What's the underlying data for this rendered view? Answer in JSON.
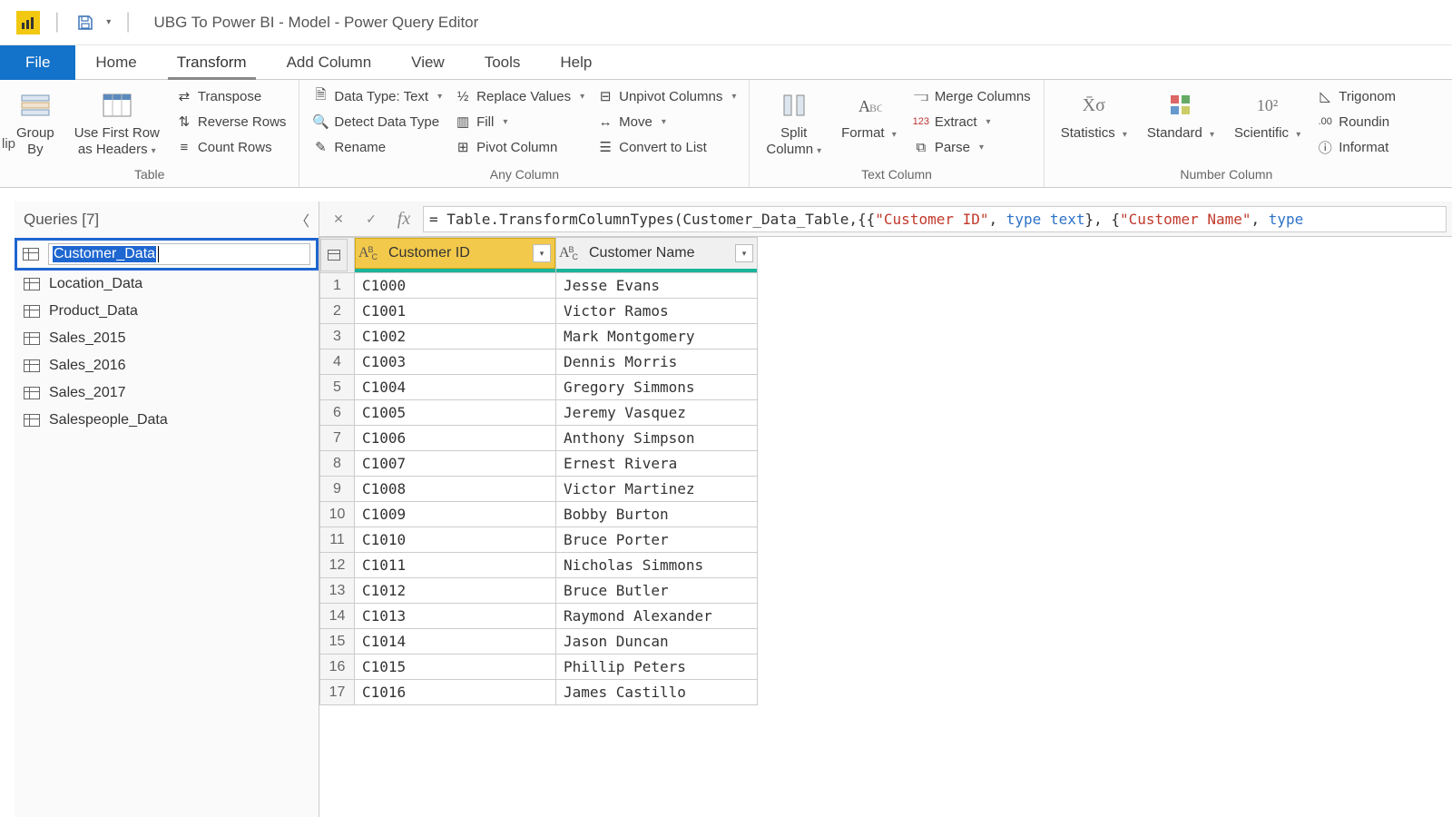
{
  "window": {
    "title": "UBG To Power BI - Model - Power Query Editor"
  },
  "tabs": {
    "file": "File",
    "items": [
      "Home",
      "Transform",
      "Add Column",
      "View",
      "Tools",
      "Help"
    ],
    "selected": "Transform"
  },
  "ribbon": {
    "groups": {
      "table": {
        "label": "Table",
        "group_by": "Group\nBy",
        "use_first_row": "Use First Row\nas Headers",
        "transpose": "Transpose",
        "reverse_rows": "Reverse Rows",
        "count_rows": "Count Rows"
      },
      "any_column": {
        "label": "Any Column",
        "data_type": "Data Type: Text",
        "detect": "Detect Data Type",
        "rename": "Rename",
        "replace": "Replace Values",
        "fill": "Fill",
        "pivot": "Pivot Column",
        "unpivot": "Unpivot Columns",
        "move": "Move",
        "convert": "Convert to List"
      },
      "text_column": {
        "label": "Text Column",
        "split": "Split\nColumn",
        "format": "Format",
        "merge": "Merge Columns",
        "extract": "Extract",
        "parse": "Parse"
      },
      "number_column": {
        "label": "Number Column",
        "statistics": "Statistics",
        "standard": "Standard",
        "scientific": "Scientific",
        "trig": "Trigonom",
        "rounding": "Roundin",
        "info": "Informat"
      }
    }
  },
  "queries": {
    "header": "Queries [7]",
    "editing_value": "Customer_Data",
    "items": [
      "Location_Data",
      "Product_Data",
      "Sales_2015",
      "Sales_2016",
      "Sales_2017",
      "Salespeople_Data"
    ]
  },
  "formula": {
    "prefix": "= Table.TransformColumnTypes(Customer_Data_Table,{{",
    "s1": "\"Customer ID\"",
    "mid1": ", ",
    "kw1": "type text",
    "mid2": "}, {",
    "s2": "\"Customer Name\"",
    "mid3": ", ",
    "kw2": "type"
  },
  "grid": {
    "columns": [
      {
        "name": "Customer ID",
        "selected": true
      },
      {
        "name": "Customer Name",
        "selected": false
      }
    ],
    "rows": [
      {
        "n": 1,
        "id": "C1000",
        "name": "Jesse Evans"
      },
      {
        "n": 2,
        "id": "C1001",
        "name": "Victor Ramos"
      },
      {
        "n": 3,
        "id": "C1002",
        "name": "Mark Montgomery"
      },
      {
        "n": 4,
        "id": "C1003",
        "name": "Dennis Morris"
      },
      {
        "n": 5,
        "id": "C1004",
        "name": "Gregory Simmons"
      },
      {
        "n": 6,
        "id": "C1005",
        "name": "Jeremy Vasquez"
      },
      {
        "n": 7,
        "id": "C1006",
        "name": "Anthony Simpson"
      },
      {
        "n": 8,
        "id": "C1007",
        "name": "Ernest Rivera"
      },
      {
        "n": 9,
        "id": "C1008",
        "name": "Victor Martinez"
      },
      {
        "n": 10,
        "id": "C1009",
        "name": "Bobby Burton"
      },
      {
        "n": 11,
        "id": "C1010",
        "name": "Bruce Porter"
      },
      {
        "n": 12,
        "id": "C1011",
        "name": "Nicholas Simmons"
      },
      {
        "n": 13,
        "id": "C1012",
        "name": "Bruce Butler"
      },
      {
        "n": 14,
        "id": "C1013",
        "name": "Raymond Alexander"
      },
      {
        "n": 15,
        "id": "C1014",
        "name": "Jason Duncan"
      },
      {
        "n": 16,
        "id": "C1015",
        "name": "Phillip Peters"
      },
      {
        "n": 17,
        "id": "C1016",
        "name": "James Castillo"
      }
    ]
  },
  "misc": {
    "clip": "lip"
  }
}
